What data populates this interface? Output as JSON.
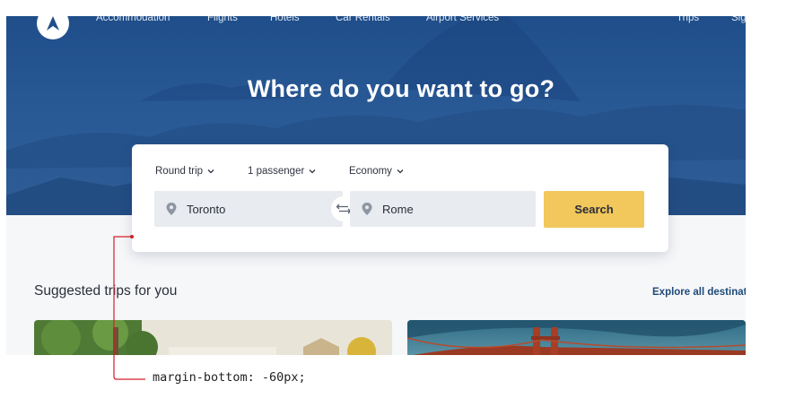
{
  "nav": {
    "items": [
      "Accommodation",
      "Flights",
      "Hotels",
      "Car Rentals",
      "Airport Services"
    ],
    "right_items": [
      "Trips",
      "Sig"
    ]
  },
  "hero": {
    "title": "Where do you want to go?"
  },
  "search": {
    "trip_type": "Round trip",
    "passengers": "1 passenger",
    "cabin": "Economy",
    "from": "Toronto",
    "to": "Rome",
    "button_label": "Search"
  },
  "section": {
    "title": "Suggested trips for you",
    "explore_link": "Explore all destinati"
  },
  "annotation": {
    "label": "margin-bottom: -60px;",
    "color": "#d0202a"
  },
  "colors": {
    "hero_blue": "#295995",
    "accent_yellow": "#f2c75c",
    "link_blue": "#1e4a78"
  },
  "icons": [
    "logo-icon",
    "chevron-down-icon",
    "location-pin-icon",
    "swap-arrows-icon"
  ]
}
